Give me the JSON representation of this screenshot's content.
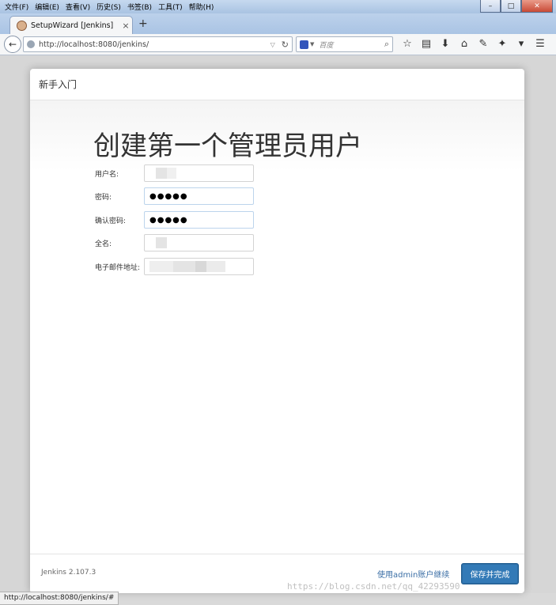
{
  "menu": [
    "文件(F)",
    "编辑(E)",
    "查看(V)",
    "历史(S)",
    "书签(B)",
    "工具(T)",
    "帮助(H)"
  ],
  "window_controls": {
    "minimize": "–",
    "maximize": "□",
    "close": "✕"
  },
  "tab": {
    "title": "SetupWizard [Jenkins]",
    "close": "×"
  },
  "new_tab": "+",
  "address_bar": {
    "url": "http://localhost:8080/jenkins/"
  },
  "search_box": {
    "placeholder": "百度"
  },
  "dialog": {
    "header": "新手入门",
    "title": "创建第一个管理员用户",
    "fields": [
      {
        "label": "用户名:",
        "value": ""
      },
      {
        "label": "密码:",
        "value": "●●●●●"
      },
      {
        "label": "确认密码:",
        "value": "●●●●●"
      },
      {
        "label": "全名:",
        "value": ""
      },
      {
        "label": "电子邮件地址:",
        "value": ""
      }
    ],
    "footer": {
      "version": "Jenkins 2.107.3",
      "continue_link": "使用admin账户继续",
      "save_button": "保存并完成"
    }
  },
  "status_bar": "http://localhost:8080/jenkins/#",
  "watermark": "https://blog.csdn.net/qq_42293590",
  "colors": {
    "primary_button": "#337ab7",
    "link": "#3a6ea5"
  }
}
